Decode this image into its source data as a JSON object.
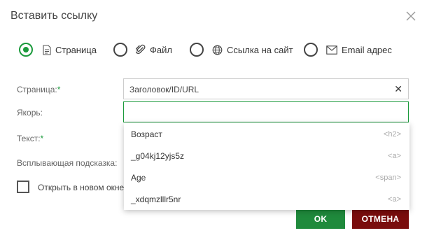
{
  "dialog": {
    "title": "Вставить ссылку"
  },
  "types": [
    {
      "label": "Страница",
      "icon": "page-icon",
      "checked": true
    },
    {
      "label": "Файл",
      "icon": "paperclip-icon",
      "checked": false
    },
    {
      "label": "Ссылка на сайт",
      "icon": "globe-icon",
      "checked": false
    },
    {
      "label": "Email адрес",
      "icon": "envelope-icon",
      "checked": false
    }
  ],
  "form": {
    "page_label": "Страница:",
    "page_required": "*",
    "page_value": "Заголовок/ID/URL",
    "anchor_label": "Якорь:",
    "anchor_value": "",
    "text_label": "Текст:",
    "text_required": "*",
    "tooltip_label": "Всплывающая подсказка:",
    "new_window_label": "Открыть в новом окне"
  },
  "dropdown": {
    "items": [
      {
        "name": "Возраст",
        "tag": "<h2>"
      },
      {
        "name": "_g04kj12yjs5z",
        "tag": "<a>"
      },
      {
        "name": "Age",
        "tag": "<span>"
      },
      {
        "name": "_xdqmzlllr5nr",
        "tag": "<a>"
      }
    ]
  },
  "buttons": {
    "ok": "OK",
    "cancel": "ОТМЕНА"
  },
  "colors": {
    "accent": "#1b9a3c",
    "ok_button": "#1f8a3c",
    "cancel_button": "#7a0d0d"
  }
}
